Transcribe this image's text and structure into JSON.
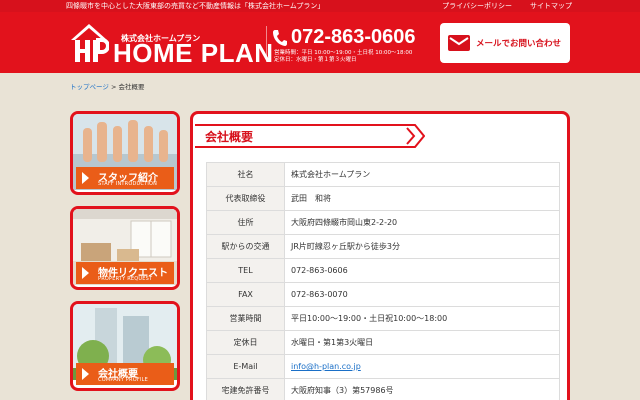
{
  "topbar": {
    "tagline": "四條畷市を中心とした大阪東部の売買など不動産情報は「株式会社ホームプラン」",
    "links": [
      "プライバシーポリシー",
      "サイトマップ"
    ]
  },
  "header": {
    "company_sub": "株式会社ホームプラン",
    "company_name": "HOME PLAN",
    "phone": "072-863-0606",
    "hours_line1": "営業時間：平日 10:00〜19:00・土日祝 10:00〜18:00",
    "hours_line2": "定休日：水曜日・第１第３火曜日",
    "mail_button": "メールでお問い合わせ"
  },
  "breadcrumb": {
    "home": "トップページ",
    "separator": " > ",
    "current": "会社概要"
  },
  "sidebar": {
    "cards": [
      {
        "label": "スタッフ紹介",
        "sub": "STAFF INTRODUCTION"
      },
      {
        "label": "物件リクエスト",
        "sub": "PROPERTY REQUEST"
      },
      {
        "label": "会社概要",
        "sub": "COMPANY PROFILE"
      }
    ]
  },
  "main": {
    "title": "会社概要",
    "rows": [
      {
        "label": "社名",
        "value": "株式会社ホームプラン"
      },
      {
        "label": "代表取締役",
        "value": "武田　和将"
      },
      {
        "label": "住所",
        "value": "大阪府四條畷市岡山東2-2-20"
      },
      {
        "label": "駅からの交通",
        "value": "JR片町線忍ヶ丘駅から徒歩3分"
      },
      {
        "label": "TEL",
        "value": "072-863-0606"
      },
      {
        "label": "FAX",
        "value": "072-863-0070"
      },
      {
        "label": "営業時間",
        "value": "平日10:00〜19:00・土日祝10:00〜18:00"
      },
      {
        "label": "定休日",
        "value": "水曜日・第1第3火曜日"
      },
      {
        "label": "E-Mail",
        "value": "info@h-plan.co.jp"
      },
      {
        "label": "宅建免許番号",
        "value": "大阪府知事（3）第57986号"
      }
    ]
  },
  "colors": {
    "brand_red": "#e2121c",
    "accent_orange": "#ea5d18",
    "background": "#e9e3d6",
    "link": "#1a6fc7"
  },
  "icons": [
    "logo-mark-icon",
    "phone-icon",
    "mail-icon",
    "arrow-icon"
  ]
}
